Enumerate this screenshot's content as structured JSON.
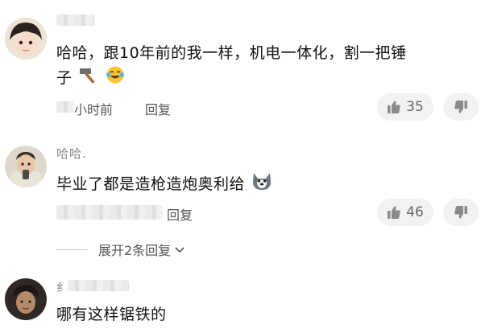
{
  "comments": [
    {
      "text_line1": "哈哈，跟10年前的我一样，机电一体化，割一把锤",
      "text_line2": "子",
      "time": "小时前",
      "reply_label": "回复",
      "likes": "35"
    },
    {
      "name": "哈哈.",
      "text": "毕业了都是造枪造炮奥利给",
      "reply_label": "回复",
      "likes": "46"
    },
    {
      "name": "纟",
      "text": "哪有这样锯铁的"
    }
  ],
  "expand_replies": {
    "label": "展开2条回复"
  },
  "icons": {
    "emoji_1": "hammer-icon",
    "emoji_2": "laughing-tears-icon",
    "emoji_3": "doge-icon"
  }
}
